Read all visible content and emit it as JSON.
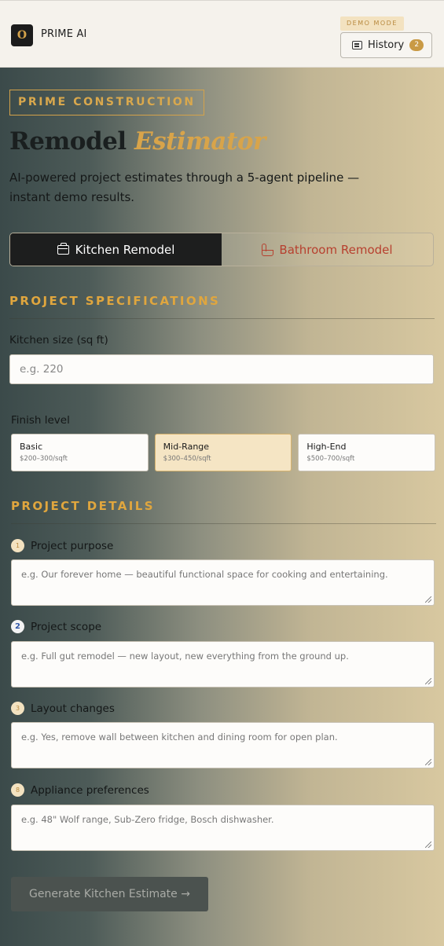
{
  "header": {
    "logo_letter": "O",
    "brand": "PRIME AI",
    "demo_badge": "DEMO MODE",
    "history_label": "History",
    "history_count": "2"
  },
  "hero": {
    "tag": "PRIME CONSTRUCTION",
    "title_main": "Remodel",
    "title_accent": "Estimator",
    "subtitle": "AI-powered project estimates through a 5-agent pipeline — instant demo results."
  },
  "project_types": [
    {
      "label": "Kitchen Remodel",
      "icon": "briefcase-icon",
      "active": true
    },
    {
      "label": "Bathroom Remodel",
      "icon": "bathtub-icon",
      "active": false
    }
  ],
  "specs": {
    "section_title": "PROJECT SPECIFICATIONS",
    "size_label": "Kitchen size (sq ft)",
    "size_placeholder": "e.g. 220",
    "finish_label": "Finish level",
    "finish_options": [
      {
        "name": "Basic",
        "price": "$200–300/sqft",
        "selected": false
      },
      {
        "name": "Mid-Range",
        "price": "$300–450/sqft",
        "selected": true
      },
      {
        "name": "High-End",
        "price": "$500–700/sqft",
        "selected": false
      }
    ]
  },
  "details": {
    "section_title": "PROJECT DETAILS",
    "fields": [
      {
        "num": "1",
        "label": "Project purpose",
        "placeholder": "e.g. Our forever home — beautiful functional space for cooking and entertaining."
      },
      {
        "num": "2",
        "label": "Project scope",
        "placeholder": "e.g. Full gut remodel — new layout, new everything from the ground up."
      },
      {
        "num": "3",
        "label": "Layout changes",
        "placeholder": "e.g. Yes, remove wall between kitchen and dining room for open plan."
      },
      {
        "num": "8",
        "label": "Appliance preferences",
        "placeholder": "e.g. 48\" Wolf range, Sub-Zero fridge, Bosch dishwasher."
      }
    ]
  },
  "submit_label": "Generate Kitchen Estimate →",
  "colors": {
    "accent": "#d4a24a",
    "dark": "#1d1e1e",
    "bathroom_text": "#b7402f"
  }
}
